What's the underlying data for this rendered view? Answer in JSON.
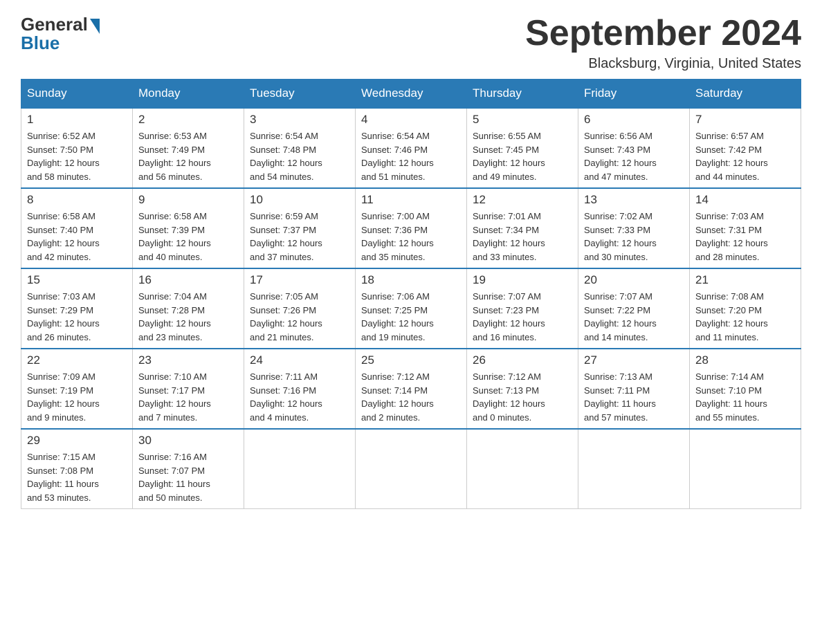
{
  "header": {
    "logo": {
      "general": "General",
      "blue": "Blue"
    },
    "title": "September 2024",
    "location": "Blacksburg, Virginia, United States"
  },
  "weekdays": [
    "Sunday",
    "Monday",
    "Tuesday",
    "Wednesday",
    "Thursday",
    "Friday",
    "Saturday"
  ],
  "weeks": [
    [
      {
        "day": "1",
        "sunrise": "6:52 AM",
        "sunset": "7:50 PM",
        "daylight": "12 hours and 58 minutes."
      },
      {
        "day": "2",
        "sunrise": "6:53 AM",
        "sunset": "7:49 PM",
        "daylight": "12 hours and 56 minutes."
      },
      {
        "day": "3",
        "sunrise": "6:54 AM",
        "sunset": "7:48 PM",
        "daylight": "12 hours and 54 minutes."
      },
      {
        "day": "4",
        "sunrise": "6:54 AM",
        "sunset": "7:46 PM",
        "daylight": "12 hours and 51 minutes."
      },
      {
        "day": "5",
        "sunrise": "6:55 AM",
        "sunset": "7:45 PM",
        "daylight": "12 hours and 49 minutes."
      },
      {
        "day": "6",
        "sunrise": "6:56 AM",
        "sunset": "7:43 PM",
        "daylight": "12 hours and 47 minutes."
      },
      {
        "day": "7",
        "sunrise": "6:57 AM",
        "sunset": "7:42 PM",
        "daylight": "12 hours and 44 minutes."
      }
    ],
    [
      {
        "day": "8",
        "sunrise": "6:58 AM",
        "sunset": "7:40 PM",
        "daylight": "12 hours and 42 minutes."
      },
      {
        "day": "9",
        "sunrise": "6:58 AM",
        "sunset": "7:39 PM",
        "daylight": "12 hours and 40 minutes."
      },
      {
        "day": "10",
        "sunrise": "6:59 AM",
        "sunset": "7:37 PM",
        "daylight": "12 hours and 37 minutes."
      },
      {
        "day": "11",
        "sunrise": "7:00 AM",
        "sunset": "7:36 PM",
        "daylight": "12 hours and 35 minutes."
      },
      {
        "day": "12",
        "sunrise": "7:01 AM",
        "sunset": "7:34 PM",
        "daylight": "12 hours and 33 minutes."
      },
      {
        "day": "13",
        "sunrise": "7:02 AM",
        "sunset": "7:33 PM",
        "daylight": "12 hours and 30 minutes."
      },
      {
        "day": "14",
        "sunrise": "7:03 AM",
        "sunset": "7:31 PM",
        "daylight": "12 hours and 28 minutes."
      }
    ],
    [
      {
        "day": "15",
        "sunrise": "7:03 AM",
        "sunset": "7:29 PM",
        "daylight": "12 hours and 26 minutes."
      },
      {
        "day": "16",
        "sunrise": "7:04 AM",
        "sunset": "7:28 PM",
        "daylight": "12 hours and 23 minutes."
      },
      {
        "day": "17",
        "sunrise": "7:05 AM",
        "sunset": "7:26 PM",
        "daylight": "12 hours and 21 minutes."
      },
      {
        "day": "18",
        "sunrise": "7:06 AM",
        "sunset": "7:25 PM",
        "daylight": "12 hours and 19 minutes."
      },
      {
        "day": "19",
        "sunrise": "7:07 AM",
        "sunset": "7:23 PM",
        "daylight": "12 hours and 16 minutes."
      },
      {
        "day": "20",
        "sunrise": "7:07 AM",
        "sunset": "7:22 PM",
        "daylight": "12 hours and 14 minutes."
      },
      {
        "day": "21",
        "sunrise": "7:08 AM",
        "sunset": "7:20 PM",
        "daylight": "12 hours and 11 minutes."
      }
    ],
    [
      {
        "day": "22",
        "sunrise": "7:09 AM",
        "sunset": "7:19 PM",
        "daylight": "12 hours and 9 minutes."
      },
      {
        "day": "23",
        "sunrise": "7:10 AM",
        "sunset": "7:17 PM",
        "daylight": "12 hours and 7 minutes."
      },
      {
        "day": "24",
        "sunrise": "7:11 AM",
        "sunset": "7:16 PM",
        "daylight": "12 hours and 4 minutes."
      },
      {
        "day": "25",
        "sunrise": "7:12 AM",
        "sunset": "7:14 PM",
        "daylight": "12 hours and 2 minutes."
      },
      {
        "day": "26",
        "sunrise": "7:12 AM",
        "sunset": "7:13 PM",
        "daylight": "12 hours and 0 minutes."
      },
      {
        "day": "27",
        "sunrise": "7:13 AM",
        "sunset": "7:11 PM",
        "daylight": "11 hours and 57 minutes."
      },
      {
        "day": "28",
        "sunrise": "7:14 AM",
        "sunset": "7:10 PM",
        "daylight": "11 hours and 55 minutes."
      }
    ],
    [
      {
        "day": "29",
        "sunrise": "7:15 AM",
        "sunset": "7:08 PM",
        "daylight": "11 hours and 53 minutes."
      },
      {
        "day": "30",
        "sunrise": "7:16 AM",
        "sunset": "7:07 PM",
        "daylight": "11 hours and 50 minutes."
      },
      null,
      null,
      null,
      null,
      null
    ]
  ]
}
